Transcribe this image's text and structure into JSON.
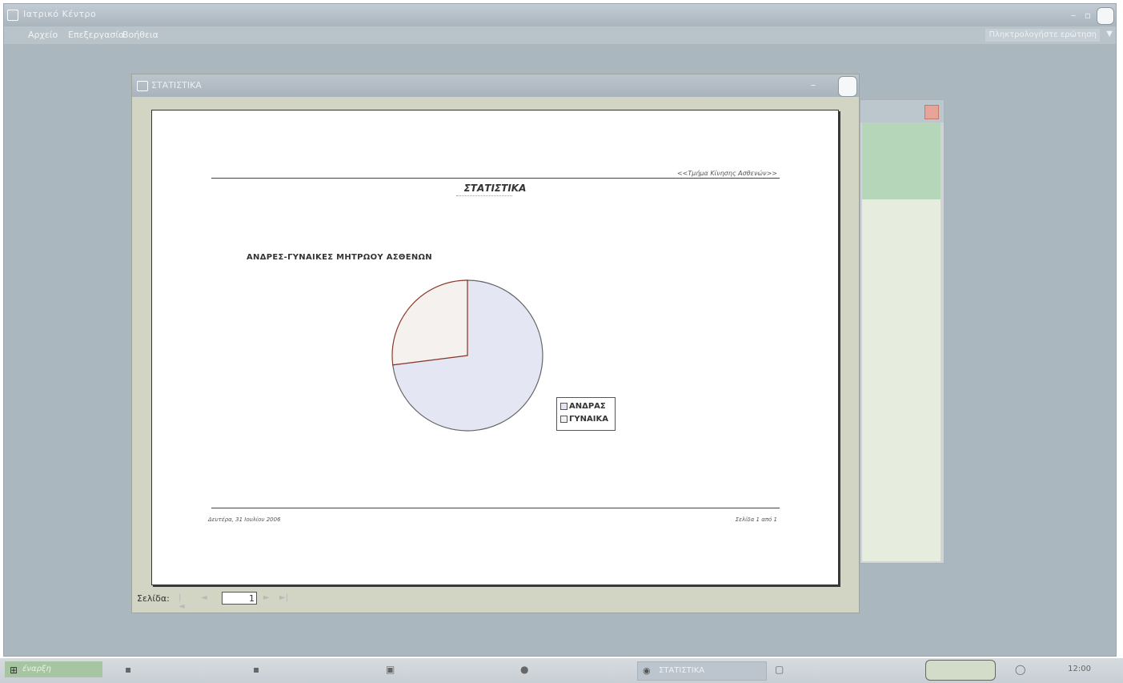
{
  "app": {
    "title": "Ιατρικό Κέντρο",
    "menu": [
      "Αρχείο",
      "Επεξεργασία",
      "Βοήθεια"
    ],
    "help_placeholder": "Πληκτρολογήστε ερώτηση",
    "window_buttons": {
      "minimize": "–",
      "restore": "▫",
      "close": ""
    }
  },
  "report_window": {
    "title": "ΣΤΑΤΙΣΤΙΚΑ",
    "page": {
      "header_right": "<<Τμήμα Κίνησης Ασθενών>>",
      "title": "ΣΤΑΤΙΣΤΙΚΑ",
      "chart_title": "ΑΝΔΡΕΣ-ΓΥΝΑΙΚΕΣ ΜΗΤΡΩΟΥ ΑΣΘΕΝΩΝ",
      "footer_left": "Δευτέρα, 31 Ιουλίου 2006",
      "footer_right": "Σελίδα 1 από 1"
    },
    "nav": {
      "label": "Σελίδα:",
      "first": "|◄",
      "prev": "◄",
      "page_value": "1",
      "next": "►",
      "last": "►|"
    }
  },
  "chart_data": {
    "type": "pie",
    "categories": [
      "ΑΝΔΡΑΣ",
      "ΓΥΝΑΙΚΑ"
    ],
    "values": [
      73,
      27
    ],
    "title": "ΑΝΔΡΕΣ-ΓΥΝΑΙΚΕΣ ΜΗΤΡΩΟΥ ΑΣΘΕΝΩΝ",
    "legend": "right",
    "colors": [
      "#e4e7f3",
      "#f5f1ee"
    ]
  },
  "legend": {
    "items": [
      {
        "label": "ΑΝΔΡΑΣ",
        "color": "#e4e7f3"
      },
      {
        "label": "ΓΥΝΑΙΚΑ",
        "color": "#f5f1ee"
      }
    ]
  },
  "taskbar": {
    "start_label": "έναρξη",
    "active_button": "ΣΤΑΤΙΣΤΙΚΑ",
    "clock": "12:00"
  },
  "icons": {
    "start": "windows-logo-icon",
    "app": "access-icon"
  }
}
